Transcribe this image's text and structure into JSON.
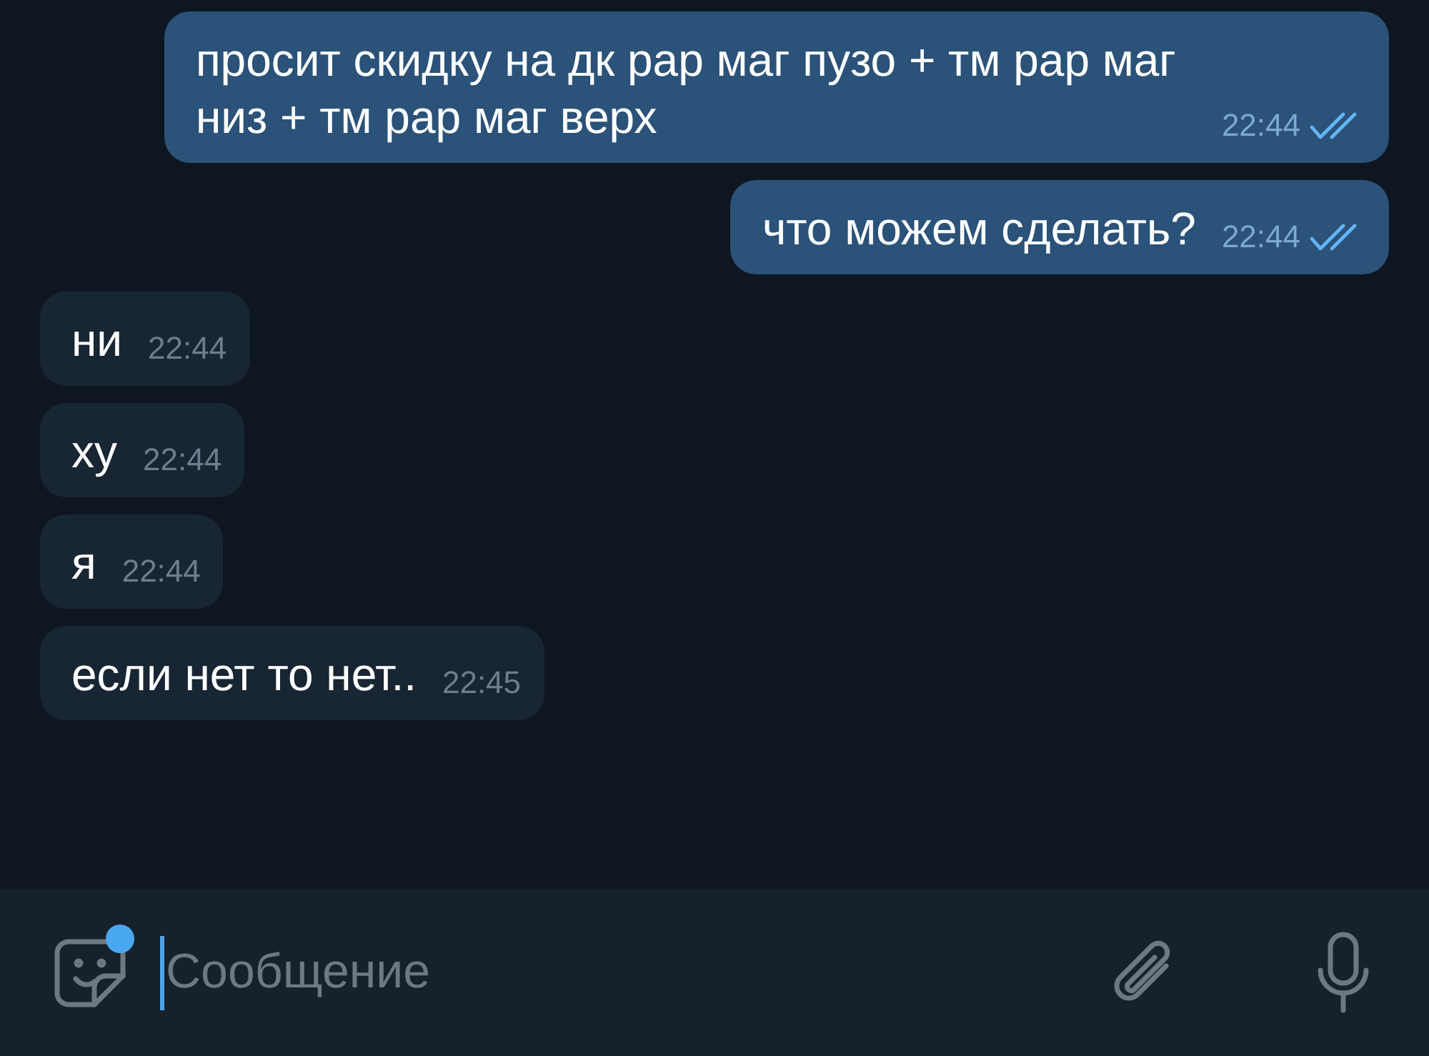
{
  "messages": [
    {
      "kind": "outgoing",
      "text": "просит скидку на дк рар маг пузо + тм рар маг низ + тм рар маг верх",
      "time": "22:44",
      "read": true
    },
    {
      "kind": "outgoing",
      "text": "что можем сделать?",
      "time": "22:44",
      "read": true
    },
    {
      "kind": "incoming",
      "text": "ни",
      "time": "22:44"
    },
    {
      "kind": "incoming",
      "text": "ху",
      "time": "22:44"
    },
    {
      "kind": "incoming",
      "text": "я",
      "time": "22:44"
    },
    {
      "kind": "incoming",
      "text": "если нет то нет..",
      "time": "22:45"
    }
  ],
  "composer": {
    "placeholder": "Сообщение",
    "sticker_badge": true
  }
}
